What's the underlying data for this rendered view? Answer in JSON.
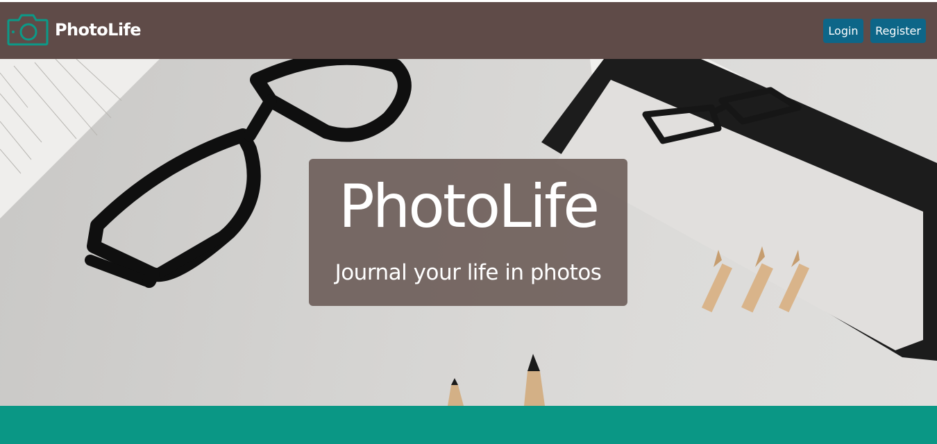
{
  "header": {
    "brand": {
      "name": "PhotoLife",
      "icon": "camera-icon"
    },
    "nav": {
      "login_label": "Login",
      "register_label": "Register"
    }
  },
  "hero": {
    "title": "PhotoLife",
    "subtitle": "Journal your life in photos",
    "background_image": "glasses-tablet-pencils-photo"
  },
  "colors": {
    "navbar": "#5f4b48",
    "brand_icon": "#0b9a88",
    "button": "#0d6688",
    "hero_overlay": "#665652",
    "footer_band": "#0a9785"
  }
}
